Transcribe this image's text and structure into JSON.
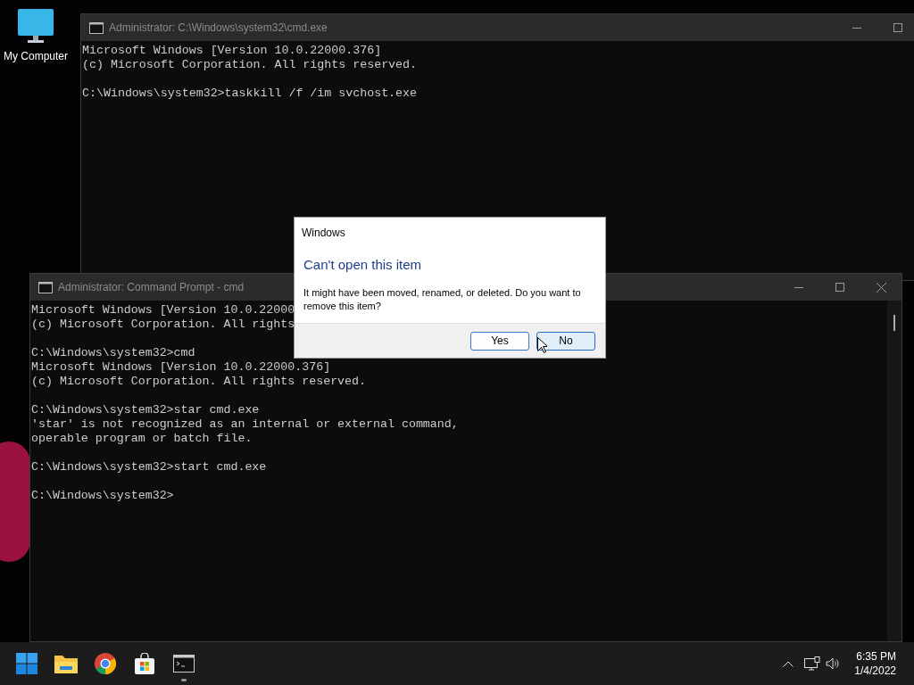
{
  "desktop": {
    "icons": [
      {
        "label": "My Computer"
      }
    ]
  },
  "windows": [
    {
      "title": "Administrator: C:\\Windows\\system32\\cmd.exe",
      "close_visible": false,
      "blocks": [
        [
          "Microsoft Windows [Version 10.0.22000.376]",
          "(c) Microsoft Corporation. All rights reserved."
        ],
        [
          "C:\\Windows\\system32>taskkill /f /im svchost.exe"
        ]
      ]
    },
    {
      "title": "Administrator: Command Prompt - cmd",
      "close_visible": true,
      "blocks": [
        [
          "Microsoft Windows [Version 10.0.22000",
          "(c) Microsoft Corporation. All rights"
        ],
        [
          "C:\\Windows\\system32>cmd",
          "Microsoft Windows [Version 10.0.22000.376]",
          "(c) Microsoft Corporation. All rights reserved."
        ],
        [
          "C:\\Windows\\system32>star cmd.exe",
          "'star' is not recognized as an internal or external command,",
          "operable program or batch file."
        ],
        [
          "C:\\Windows\\system32>start cmd.exe"
        ],
        [
          "C:\\Windows\\system32>"
        ]
      ]
    }
  ],
  "dialog": {
    "title": "Windows",
    "heading": "Can't open this item",
    "message": "It might have been moved, renamed, or deleted. Do you want to remove this item?",
    "buttons": [
      {
        "label": "Yes",
        "selected": false
      },
      {
        "label": "No",
        "selected": true
      }
    ]
  },
  "taskbar": {
    "apps": [
      {
        "kind": "start",
        "running": false
      },
      {
        "kind": "explorer",
        "running": false
      },
      {
        "kind": "chrome",
        "running": false
      },
      {
        "kind": "store",
        "running": false
      },
      {
        "kind": "terminal",
        "running": true
      }
    ],
    "clock": {
      "time": "6:35 PM",
      "date": "1/4/2022"
    }
  }
}
